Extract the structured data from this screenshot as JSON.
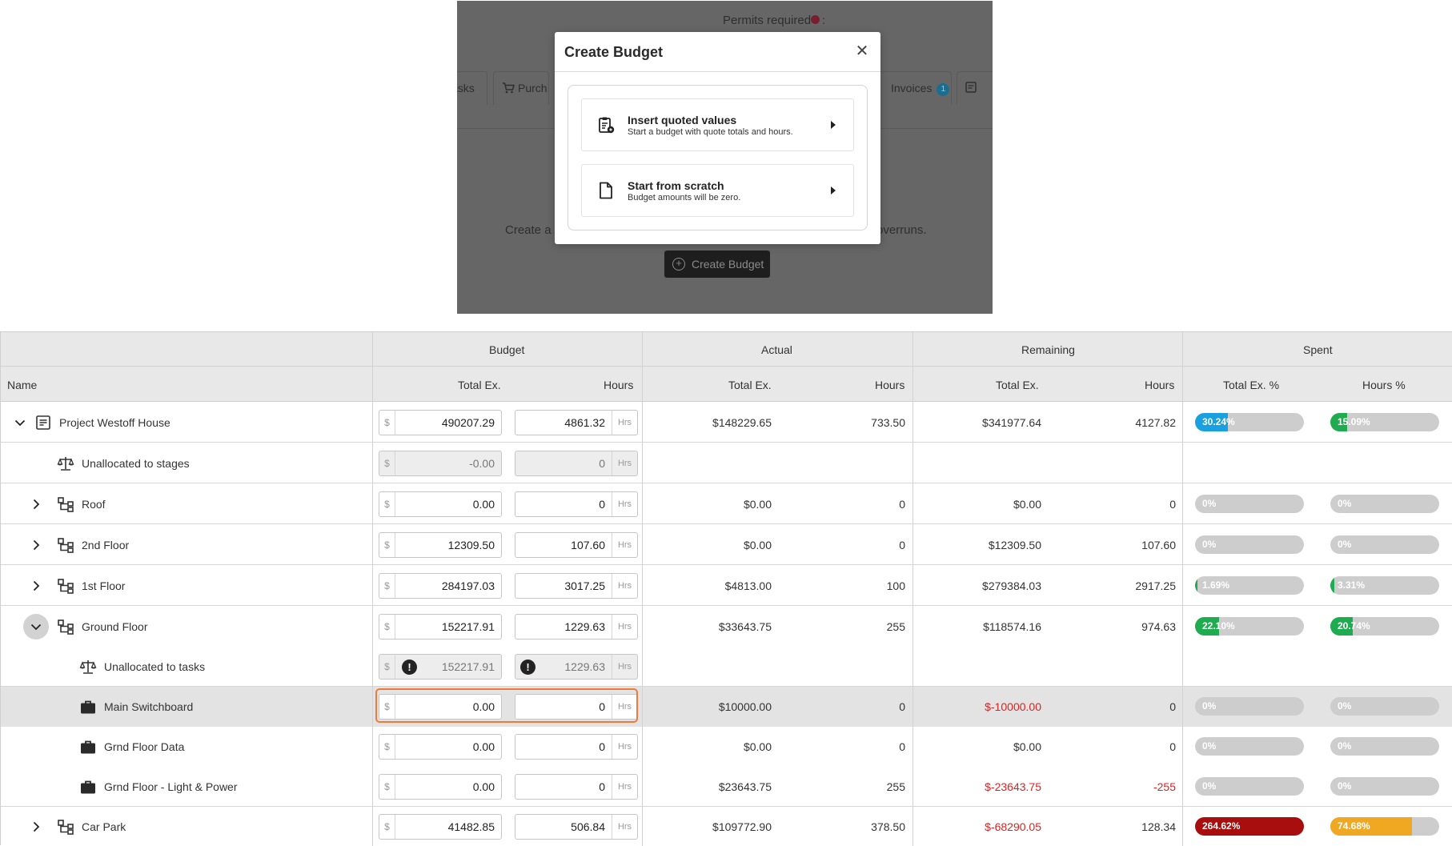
{
  "background_page": {
    "permits_label": "Permits required",
    "permits_colon": ":",
    "tabs": {
      "tasks": "asks",
      "purchases": "Purch",
      "invoices": "Invoices",
      "invoices_badge": "1"
    },
    "create_text_left": "Create a",
    "create_text_right": "overruns.",
    "create_budget_button": "Create Budget"
  },
  "modal": {
    "title": "Create Budget",
    "close_icon": "close-icon",
    "options": [
      {
        "title": "Insert quoted values",
        "subtitle": "Start a budget with quote totals and hours.",
        "icon": "clipboard-quote-icon"
      },
      {
        "title": "Start from scratch",
        "subtitle": "Budget amounts will be zero.",
        "icon": "blank-document-icon"
      }
    ]
  },
  "grid": {
    "groups": {
      "budget": "Budget",
      "actual": "Actual",
      "remaining": "Remaining",
      "spent": "Spent"
    },
    "columns": {
      "name": "Name",
      "budget_total": "Total Ex.",
      "budget_hours": "Hours",
      "actual_total": "Total Ex.",
      "actual_hours": "Hours",
      "remaining_total": "Total Ex.",
      "remaining_hours": "Hours",
      "spent_total": "Total Ex. %",
      "spent_hours": "Hours %"
    },
    "input_prefix": "$",
    "input_suffix": "Hrs",
    "colors": {
      "bar_track": "#cdcdcd",
      "blue": "#1aa0e0",
      "green": "#1fab4f",
      "red": "#a80e0e",
      "amber": "#f0a822",
      "negative_text": "#e02020",
      "focus": "#f07a3a"
    },
    "rows": [
      {
        "name": "Project Westoff House",
        "icon": "project-document-icon",
        "expander": "chevron-down-icon",
        "budget_total": "490207.29",
        "budget_hours": "4861.32",
        "actual_total": "$148229.65",
        "actual_hours": "733.50",
        "remaining_total": "$341977.64",
        "remaining_hours": "4127.82",
        "spent_total_label": "30.24%",
        "spent_total_pct": 30.24,
        "spent_hours_label": "15.09%",
        "spent_hours_pct": 15.09
      },
      {
        "name": "Unallocated to stages",
        "icon": "balance-scale-icon",
        "budget_total": "-0.00",
        "budget_hours": "0"
      },
      {
        "name": "Roof",
        "icon": "hierarchy-icon",
        "expander": "chevron-right-icon",
        "budget_total": "0.00",
        "budget_hours": "0",
        "actual_total": "$0.00",
        "actual_hours": "0",
        "remaining_total": "$0.00",
        "remaining_hours": "0",
        "spent_total_label": "0%",
        "spent_total_pct": 0,
        "spent_hours_label": "0%",
        "spent_hours_pct": 0
      },
      {
        "name": "2nd Floor",
        "icon": "hierarchy-icon",
        "expander": "chevron-right-icon",
        "budget_total": "12309.50",
        "budget_hours": "107.60",
        "actual_total": "$0.00",
        "actual_hours": "0",
        "remaining_total": "$12309.50",
        "remaining_hours": "107.60",
        "spent_total_label": "0%",
        "spent_total_pct": 0,
        "spent_hours_label": "0%",
        "spent_hours_pct": 0
      },
      {
        "name": "1st Floor",
        "icon": "hierarchy-icon",
        "expander": "chevron-right-icon",
        "budget_total": "284197.03",
        "budget_hours": "3017.25",
        "actual_total": "$4813.00",
        "actual_hours": "100",
        "remaining_total": "$279384.03",
        "remaining_hours": "2917.25",
        "spent_total_label": "1.69%",
        "spent_total_pct": 1.69,
        "spent_hours_label": "3.31%",
        "spent_hours_pct": 3.31
      },
      {
        "name": "Ground Floor",
        "icon": "hierarchy-icon",
        "expander": "chevron-down-icon",
        "budget_total": "152217.91",
        "budget_hours": "1229.63",
        "actual_total": "$33643.75",
        "actual_hours": "255",
        "remaining_total": "$118574.16",
        "remaining_hours": "974.63",
        "spent_total_label": "22.10%",
        "spent_total_pct": 22.1,
        "spent_hours_label": "20.74%",
        "spent_hours_pct": 20.74
      },
      {
        "name": "Unallocated to tasks",
        "icon": "balance-scale-icon",
        "budget_total": "152217.91",
        "budget_hours": "1229.63",
        "warning_icon": "exclamation-circle-icon"
      },
      {
        "name": "Main Switchboard",
        "icon": "briefcase-icon",
        "budget_total": "0.00",
        "budget_hours": "0",
        "actual_total": "$10000.00",
        "actual_hours": "0",
        "remaining_total": "$-10000.00",
        "remaining_hours": "0",
        "spent_total_label": "0%",
        "spent_total_pct": 0,
        "spent_hours_label": "0%",
        "spent_hours_pct": 0
      },
      {
        "name": "Grnd Floor Data",
        "icon": "briefcase-icon",
        "budget_total": "0.00",
        "budget_hours": "0",
        "actual_total": "$0.00",
        "actual_hours": "0",
        "remaining_total": "$0.00",
        "remaining_hours": "0",
        "spent_total_label": "0%",
        "spent_total_pct": 0,
        "spent_hours_label": "0%",
        "spent_hours_pct": 0
      },
      {
        "name": "Grnd Floor - Light & Power",
        "icon": "briefcase-icon",
        "budget_total": "0.00",
        "budget_hours": "0",
        "actual_total": "$23643.75",
        "actual_hours": "255",
        "remaining_total": "$-23643.75",
        "remaining_hours": "-255",
        "spent_total_label": "0%",
        "spent_total_pct": 0,
        "spent_hours_label": "0%",
        "spent_hours_pct": 0
      },
      {
        "name": "Car Park",
        "icon": "hierarchy-icon",
        "expander": "chevron-right-icon",
        "budget_total": "41482.85",
        "budget_hours": "506.84",
        "actual_total": "$109772.90",
        "actual_hours": "378.50",
        "remaining_total": "$-68290.05",
        "remaining_hours": "128.34",
        "spent_total_label": "264.62%",
        "spent_total_pct": 264.62,
        "spent_hours_label": "74.68%",
        "spent_hours_pct": 74.68
      }
    ]
  }
}
